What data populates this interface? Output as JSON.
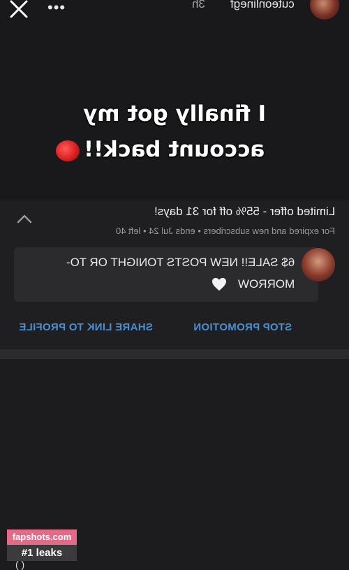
{
  "story": {
    "username": "cuteonlinegf",
    "time": "3h",
    "headline_line1": "I finally got my",
    "headline_line2": "account back!!"
  },
  "promo": {
    "title": "Limited offer - 55% off for 31 days!",
    "subtitle": "For expired and new subscribers  •  ends Jul 24  •  left 40",
    "message_line1": "6$ SALE!! NEW POSTS TONIGHT OR TO-",
    "message_line2": "MORROW",
    "share_label": "SHARE LINK TO PROFILE",
    "stop_label": "STOP PROMOTION"
  },
  "watermark": {
    "site": "fapshots.com",
    "tagline": "#1 leaks"
  },
  "icons": [
    "close-icon",
    "more-icon",
    "chevron-up-icon",
    "heart-icon"
  ],
  "colors": {
    "link": "#4a8fd3",
    "background": "#1c1c1e",
    "watermark": "#e66a87"
  }
}
